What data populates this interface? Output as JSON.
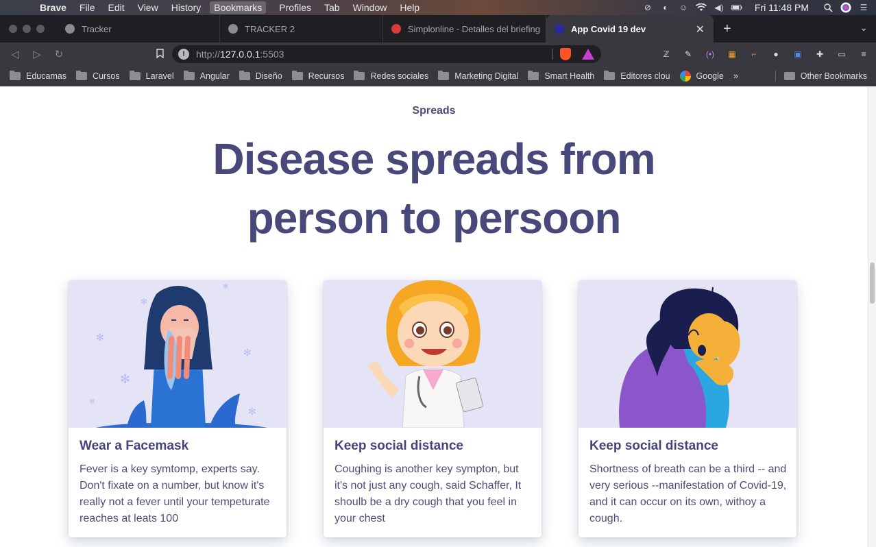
{
  "menubar": {
    "app_name": "Brave",
    "items": [
      "File",
      "Edit",
      "View",
      "History",
      "Bookmarks",
      "Profiles",
      "Tab",
      "Window",
      "Help"
    ],
    "active_item": "Bookmarks",
    "clock": "Fri 11:48 PM"
  },
  "tabs": [
    {
      "title": "Tracker",
      "favicon_color": "#8a8a90",
      "active": false
    },
    {
      "title": "TRACKER 2",
      "favicon_color": "#8a8a90",
      "active": false
    },
    {
      "title": "Simplonline - Detalles del briefing",
      "favicon_color": "#d93a3a",
      "active": false
    },
    {
      "title": "App Covid 19 dev",
      "favicon_color": "#2a2aa0",
      "active": true
    }
  ],
  "address_bar": {
    "url_prefix": "http://",
    "url_host": "127.0.0.1",
    "url_port": ":5503"
  },
  "bookmarks": [
    {
      "label": "Educamas",
      "icon": "folder-icon"
    },
    {
      "label": "Cursos",
      "icon": "folder-icon"
    },
    {
      "label": "Laravel",
      "icon": "folder-icon"
    },
    {
      "label": "Angular",
      "icon": "folder-icon"
    },
    {
      "label": "Diseño",
      "icon": "folder-icon"
    },
    {
      "label": "Recursos",
      "icon": "folder-icon"
    },
    {
      "label": "Redes sociales",
      "icon": "folder-icon"
    },
    {
      "label": "Marketing Digital",
      "icon": "folder-icon"
    },
    {
      "label": "Smart Health",
      "icon": "folder-icon"
    },
    {
      "label": "Editores clou",
      "icon": "folder-icon"
    },
    {
      "label": "Google",
      "icon": "google-icon"
    }
  ],
  "bookmarks_more": "»",
  "other_bookmarks": "Other Bookmarks",
  "page": {
    "eyebrow": "Spreads",
    "headline_line1": "Disease spreads from",
    "headline_line2": "person to persoon",
    "cards": [
      {
        "title": "Wear a Facemask",
        "body": "Fever is a key symtomp, experts say. Don't fixate on a number, but know it's really not a fever until your tempeturate reaches at leats 100",
        "illustration": "woman-sneezing-illustration"
      },
      {
        "title": "Keep social distance",
        "body": "Coughing is another key sympton, but it's not just any cough, said Schaffer, It shoulb be a dry cough that you feel in your chest",
        "illustration": "cartoon-doctor-illustration"
      },
      {
        "title": "Keep social distance",
        "body": "Shortness of breath can be a third -- and very serious --manifestation of Covid-19, and it can occur on its own, withoy a cough.",
        "illustration": "woman-coughing-illustration"
      }
    ]
  },
  "colors": {
    "heading": "#48487a",
    "card_image_bg": "#e5e3f6",
    "brave_orange": "#fb542b"
  }
}
